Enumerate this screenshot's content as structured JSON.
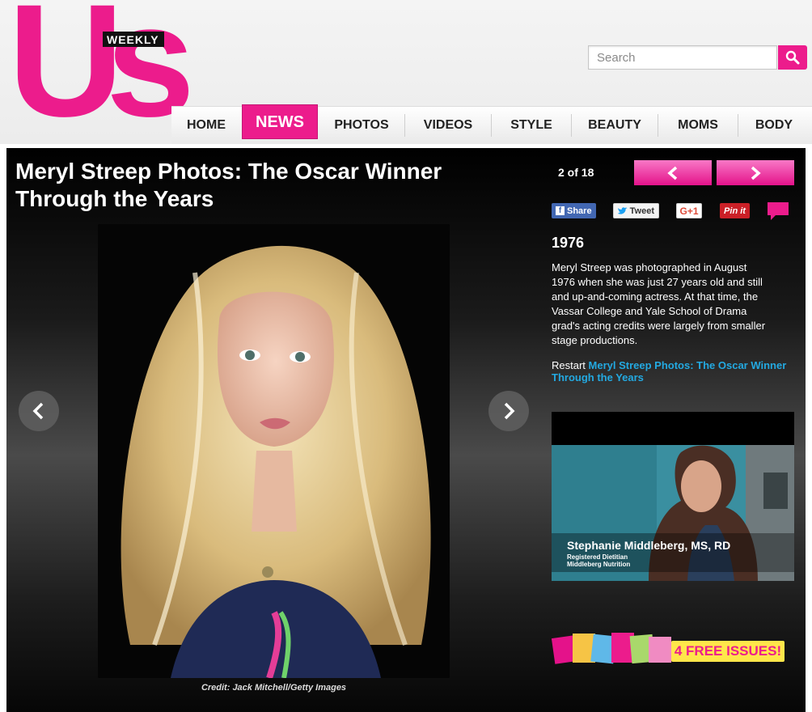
{
  "brand": {
    "logo_main": "Us",
    "logo_badge": "WEEKLY",
    "accent": "#ec1c8c"
  },
  "search": {
    "placeholder": "Search",
    "button_icon": "search-icon"
  },
  "nav": {
    "items": [
      {
        "label": "HOME"
      },
      {
        "label": "NEWS",
        "active": true
      },
      {
        "label": "PHOTOS"
      },
      {
        "label": "VIDEOS"
      },
      {
        "label": "STYLE"
      },
      {
        "label": "BEAUTY"
      },
      {
        "label": "MOMS"
      },
      {
        "label": "BODY"
      }
    ]
  },
  "gallery": {
    "title": "Meryl Streep Photos: The Oscar Winner Through the Years",
    "counter": "2 of 18",
    "credit": "Credit: Jack Mitchell/Getty Images",
    "prev_icon": "chevron-left-icon",
    "next_icon": "chevron-right-icon"
  },
  "share": {
    "facebook": "Share",
    "twitter": "Tweet",
    "google": "G+1",
    "pinterest": "Pin it",
    "comment_icon": "comment-icon"
  },
  "slide": {
    "year": "1976",
    "description": "Meryl Streep was photographed in August 1976 when she was just 27 years old and still and up-and-coming actress. At that time, the Vassar College and Yale School of Drama grad's acting credits were largely from smaller stage productions.",
    "restart_prefix": "Restart ",
    "restart_link": "Meryl Streep Photos: The Oscar Winner Through the Years"
  },
  "video": {
    "name": "Stephanie Middleberg, MS, RD",
    "role": "Registered Dietitian",
    "org": "Middleberg Nutrition"
  },
  "promo": {
    "label": "4 FREE ISSUES!"
  }
}
